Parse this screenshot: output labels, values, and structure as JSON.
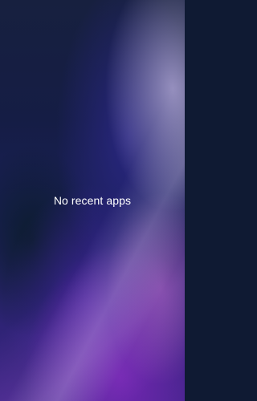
{
  "recents": {
    "empty_message": "No recent apps"
  }
}
